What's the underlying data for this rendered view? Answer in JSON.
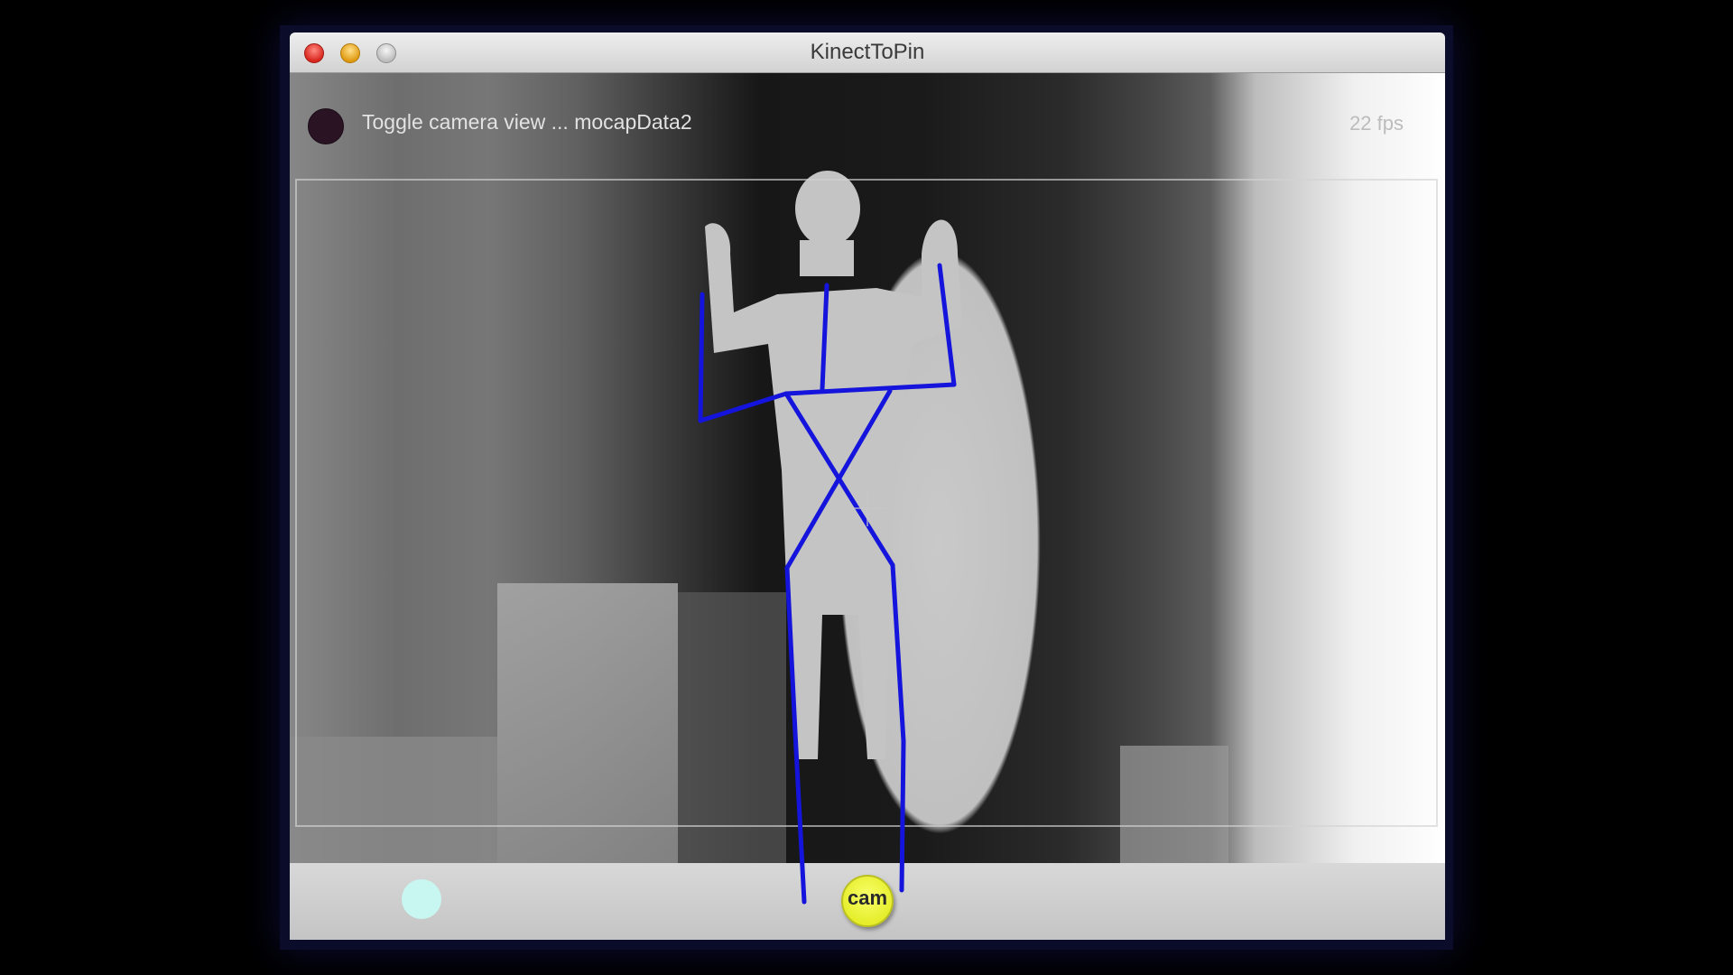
{
  "window": {
    "title": "KinectToPin"
  },
  "overlay": {
    "toggle_label": "Toggle camera view  ...  mocapData2",
    "fps": "22 fps"
  },
  "controls": {
    "cam_label": "cam"
  },
  "colors": {
    "skeleton": "#1414dc",
    "record_dot": "#2a1424",
    "cam_button": "#eef23a",
    "cyan_dot": "#c8f7f1"
  }
}
